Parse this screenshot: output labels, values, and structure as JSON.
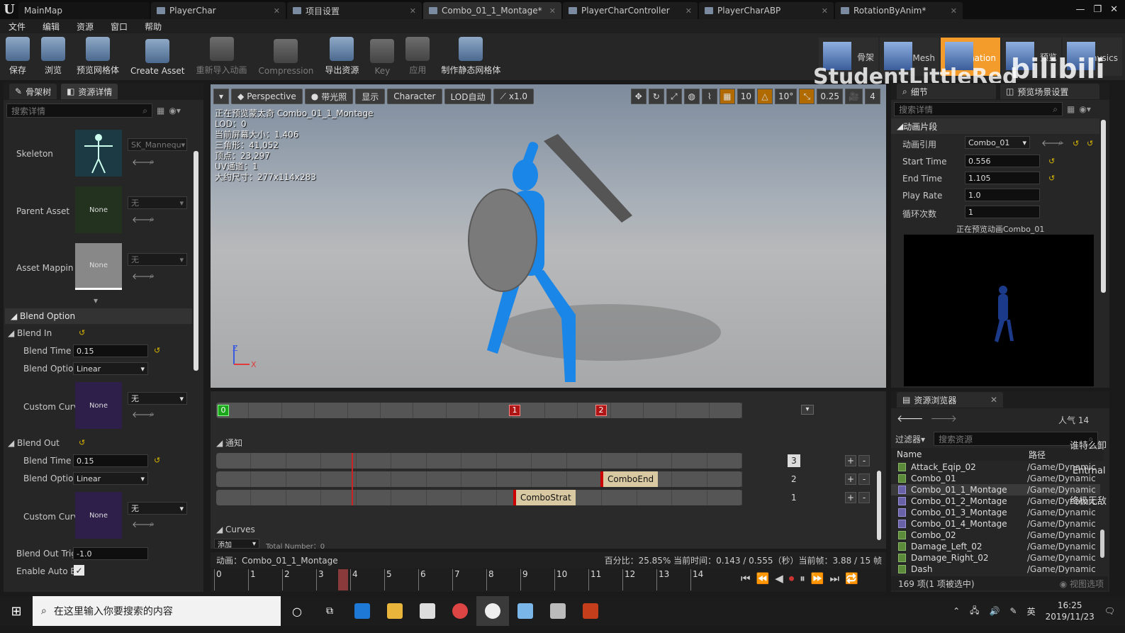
{
  "titlebar": {
    "tabs": [
      {
        "label": "MainMap"
      },
      {
        "label": "PlayerChar"
      },
      {
        "label": "项目设置"
      },
      {
        "label": "Combo_01_1_Montage*"
      },
      {
        "label": "PlayerCharController"
      },
      {
        "label": "PlayerCharABP"
      },
      {
        "label": "RotationByAnim*"
      }
    ]
  },
  "menu": [
    "文件",
    "编辑",
    "资源",
    "窗口",
    "帮助"
  ],
  "toolbar": {
    "buttons": [
      "保存",
      "浏览",
      "预览网格体",
      "Create Asset",
      "重新导入动画",
      "Compression",
      "导出资源",
      "Key",
      "应用",
      "制作静态网格体"
    ],
    "modes": [
      "骨架",
      "Mesh",
      "Animation",
      "预览",
      "Physics"
    ]
  },
  "watermark": {
    "text": "StudentLittleRed",
    "logo": "bilibili"
  },
  "left": {
    "tabs": [
      "骨架树",
      "资源详情"
    ],
    "search_placeholder": "搜索详情",
    "skeleton": {
      "label": "Skeleton",
      "value": "SK_Mannequ"
    },
    "parent": {
      "label": "Parent Asset",
      "thumb": "None",
      "value": "无"
    },
    "mapping": {
      "label": "Asset Mappin",
      "thumb": "None",
      "value": "无"
    },
    "blend_option": "Blend Option",
    "blend_in": {
      "header": "Blend In",
      "time_label": "Blend Time",
      "time": "0.15",
      "option_label": "Blend Optior",
      "option": "Linear",
      "curve_label": "Custom Curv",
      "curve_thumb": "None",
      "curve_value": "无"
    },
    "blend_out": {
      "header": "Blend Out",
      "time_label": "Blend Time",
      "time": "0.15",
      "option_label": "Blend Optior",
      "option": "Linear",
      "curve_label": "Custom Curv",
      "curve_thumb": "None",
      "curve_value": "无"
    },
    "trigger": {
      "label": "Blend Out Trig",
      "value": "-1.0"
    },
    "auto": {
      "label": "Enable Auto B"
    }
  },
  "viewport": {
    "buttons": [
      "Perspective",
      "带光照",
      "显示",
      "Character",
      "LOD自动",
      "x1.0"
    ],
    "grid": "10",
    "angle": "10°",
    "scale": "0.25",
    "speed": "4",
    "stats": [
      "正在预览蒙太奇 Combo_01_1_Montage",
      "LOD：0",
      "当前屏幕大小：1.406",
      "三角形：41,052",
      "顶点：23,297",
      "UV通道：1",
      "大约尺寸：277x114x283"
    ]
  },
  "montage": {
    "section_markers": [
      "0",
      "1",
      "2"
    ],
    "notify_header": "通知",
    "notifies": [
      "ComboEnd",
      "ComboStrat"
    ],
    "track_numbers": [
      "3",
      "2",
      "1"
    ],
    "curves_header": "Curves",
    "add_label": "添加",
    "total": "Total Number：0"
  },
  "status": {
    "anim": "动画：Combo_01_1_Montage",
    "info": "百分比：25.85% 当前时间：0.143 / 0.555（秒）当前帧：3.88 / 15 帧"
  },
  "ruler": {
    "ticks": [
      "0",
      "1",
      "2",
      "3",
      "4",
      "5",
      "6",
      "7",
      "8",
      "9",
      "10",
      "11",
      "12",
      "13",
      "14"
    ]
  },
  "right": {
    "tabs": [
      "细节",
      "预览场景设置"
    ],
    "search_placeholder": "搜索详情",
    "section": "动画片段",
    "props": [
      {
        "label": "动画引用",
        "value": "Combo_01"
      },
      {
        "label": "Start Time",
        "value": "0.556"
      },
      {
        "label": "End Time",
        "value": "1.105"
      },
      {
        "label": "Play Rate",
        "value": "1.0"
      },
      {
        "label": "循环次数",
        "value": "1"
      }
    ],
    "preview_label": "正在预览动画Combo_01"
  },
  "assets": {
    "tab": "资源浏览器",
    "popularity": "人气 14",
    "filter": "过滤器",
    "search_placeholder": "搜索资源",
    "col_name": "Name",
    "col_path": "路径",
    "items": [
      {
        "name": "Attack_Eqip_02",
        "path": "/Game/Dynamic",
        "type": "a"
      },
      {
        "name": "Combo_01",
        "path": "/Game/Dynamic",
        "type": "a"
      },
      {
        "name": "Combo_01_1_Montage",
        "path": "/Game/Dynamic",
        "type": "m"
      },
      {
        "name": "Combo_01_2_Montage",
        "path": "/Game/Dynamic",
        "type": "m"
      },
      {
        "name": "Combo_01_3_Montage",
        "path": "/Game/Dynamic",
        "type": "m"
      },
      {
        "name": "Combo_01_4_Montage",
        "path": "/Game/Dynamic",
        "type": "m"
      },
      {
        "name": "Combo_02",
        "path": "/Game/Dynamic",
        "type": "a"
      },
      {
        "name": "Damage_Left_02",
        "path": "/Game/Dynamic",
        "type": "a"
      },
      {
        "name": "Damage_Right_02",
        "path": "/Game/Dynamic",
        "type": "a"
      },
      {
        "name": "Dash",
        "path": "/Game/Dynamic",
        "type": "a"
      }
    ],
    "count": "169 项(1 项被选中)",
    "view_options": "视图选项",
    "overlay": [
      "谁特么卸",
      "Entrnal",
      "终极无敌"
    ]
  },
  "taskbar": {
    "search": "在这里输入你要搜索的内容",
    "lang": "英",
    "time": "16:25",
    "date": "2019/11/23"
  }
}
